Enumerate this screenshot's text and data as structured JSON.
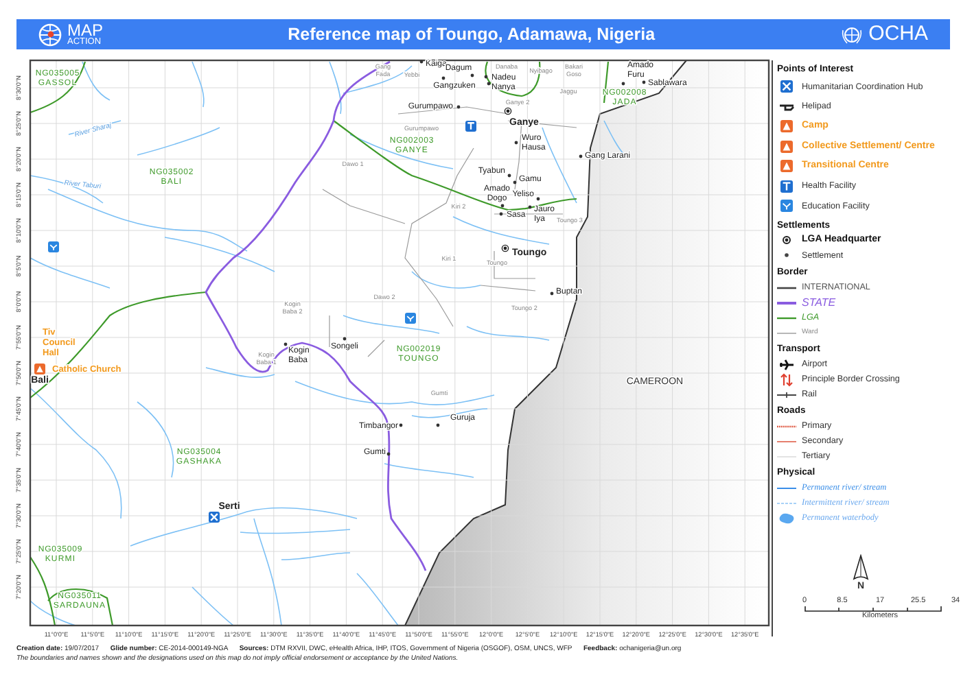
{
  "header": {
    "logo_line_1": "MAP",
    "logo_line_2": "ACTION",
    "title": "Reference map of Toungo, Adamawa, Nigeria",
    "agency": "OCHA"
  },
  "map": {
    "latitude_labels": [
      "8°30'0\"N",
      "8°25'0\"N",
      "8°20'0\"N",
      "8°15'0\"N",
      "8°10'0\"N",
      "8°5'0\"N",
      "8°0'0\"N",
      "7°55'0\"N",
      "7°50'0\"N",
      "7°45'0\"N",
      "7°40'0\"N",
      "7°35'0\"N",
      "7°30'0\"N",
      "7°25'0\"N",
      "7°20'0\"N"
    ],
    "longitude_labels": [
      "11°0'0\"E",
      "11°5'0\"E",
      "11°10'0\"E",
      "11°15'0\"E",
      "11°20'0\"E",
      "11°25'0\"E",
      "11°30'0\"E",
      "11°35'0\"E",
      "11°40'0\"E",
      "11°45'0\"E",
      "11°50'0\"E",
      "11°55'0\"E",
      "12°0'0\"E",
      "12°5'0\"E",
      "12°10'0\"E",
      "12°15'0\"E",
      "12°20'0\"E",
      "12°25'0\"E",
      "12°30'0\"E",
      "12°35'0\"E"
    ],
    "country_label": "CAMEROON",
    "admin_areas": [
      {
        "code": "NG035005",
        "name": "GASSOL"
      },
      {
        "code": "NG035002",
        "name": "BALI"
      },
      {
        "code": "NG002003",
        "name": "GANYE"
      },
      {
        "code": "NG002008",
        "name": "JADA"
      },
      {
        "code": "NG002019",
        "name": "TOUNGO"
      },
      {
        "code": "NG035004",
        "name": "GASHAKA"
      },
      {
        "code": "NG035009",
        "name": "KURMI"
      },
      {
        "code": "NG035011",
        "name": "SARDAUNA"
      }
    ],
    "settlements": [
      {
        "name": "Kaiga",
        "kind": "settlement"
      },
      {
        "name": "Dagum",
        "kind": "settlement"
      },
      {
        "name": "Gangzuken",
        "kind": "settlement"
      },
      {
        "name": "Nadeu",
        "kind": "settlement"
      },
      {
        "name": "Nanya",
        "kind": "settlement"
      },
      {
        "name": "Amado Furu",
        "kind": "settlement"
      },
      {
        "name": "Sablawara",
        "kind": "settlement"
      },
      {
        "name": "Gurumpawo",
        "kind": "settlement"
      },
      {
        "name": "Ganye",
        "kind": "lga_hq"
      },
      {
        "name": "Wuro Hausa",
        "kind": "settlement"
      },
      {
        "name": "Gang Larani",
        "kind": "settlement"
      },
      {
        "name": "Tyabun",
        "kind": "settlement"
      },
      {
        "name": "Gamu",
        "kind": "settlement"
      },
      {
        "name": "Amado Dogo",
        "kind": "settlement"
      },
      {
        "name": "Yeliso",
        "kind": "settlement"
      },
      {
        "name": "Jauro Iya",
        "kind": "settlement"
      },
      {
        "name": "Sasa",
        "kind": "settlement"
      },
      {
        "name": "Toungo",
        "kind": "lga_hq"
      },
      {
        "name": "Buptan",
        "kind": "settlement"
      },
      {
        "name": "Songeli",
        "kind": "settlement"
      },
      {
        "name": "Kogin Baba",
        "kind": "settlement"
      },
      {
        "name": "Guruja",
        "kind": "settlement"
      },
      {
        "name": "Timbangor",
        "kind": "settlement"
      },
      {
        "name": "Gumti",
        "kind": "settlement"
      },
      {
        "name": "Serti",
        "kind": "town"
      },
      {
        "name": "Bali",
        "kind": "town"
      }
    ],
    "ward_labels": [
      "Gang Fada",
      "Yebbi",
      "Danaba",
      "Nyibago",
      "Bakari Goso",
      "Jaggu",
      "Ganye 2",
      "Gurumpawo",
      "Dawo 1",
      "Kiri 2",
      "Toungo 3",
      "Kiri 1",
      "Toungo",
      "Toungo 2",
      "Dawo 2",
      "Kogin Baba 2",
      "Kogin Baba 1",
      "Gumti"
    ],
    "river_labels": [
      "River Sharaj",
      "River Taburi"
    ],
    "facilities": [
      {
        "kind": "education"
      },
      {
        "kind": "health"
      },
      {
        "kind": "education"
      },
      {
        "kind": "hub"
      }
    ],
    "camps": [
      {
        "name": "Tiv Council Hall",
        "kind": "label_only"
      },
      {
        "name": "Catholic Church",
        "kind": "camp"
      }
    ]
  },
  "legend": {
    "sections": [
      {
        "title": "Points of Interest",
        "items": [
          {
            "label": "Humanitarian Coordination Hub",
            "kind": "hub"
          },
          {
            "label": "Helipad",
            "kind": "helipad"
          },
          {
            "label": "Camp",
            "kind": "camp"
          },
          {
            "label": "Collective Settlement/ Centre",
            "kind": "collective"
          },
          {
            "label": "Transitional Centre",
            "kind": "transitional"
          },
          {
            "label": "Health Facility",
            "kind": "health"
          },
          {
            "label": "Education Facility",
            "kind": "education"
          }
        ]
      },
      {
        "title": "Settlements",
        "items": [
          {
            "label": "LGA Headquarter",
            "kind": "lga_hq"
          },
          {
            "label": "Settlement",
            "kind": "settlement"
          }
        ]
      },
      {
        "title": "Border",
        "items": [
          {
            "label": "INTERNATIONAL",
            "kind": "international"
          },
          {
            "label": "STATE",
            "kind": "state"
          },
          {
            "label": "LGA",
            "kind": "lga"
          },
          {
            "label": "Ward",
            "kind": "ward"
          }
        ]
      },
      {
        "title": "Transport",
        "items": [
          {
            "label": "Airport",
            "kind": "airport"
          },
          {
            "label": "Principle Border Crossing",
            "kind": "border_crossing"
          },
          {
            "label": "Rail",
            "kind": "rail"
          }
        ]
      },
      {
        "title": "Roads",
        "items": [
          {
            "label": "Primary",
            "kind": "primary"
          },
          {
            "label": "Secondary",
            "kind": "secondary"
          },
          {
            "label": "Tertiary",
            "kind": "tertiary"
          }
        ]
      },
      {
        "title": "Physical",
        "items": [
          {
            "label": "Permanent river/ stream",
            "kind": "river"
          },
          {
            "label": "Intermittent river/ stream",
            "kind": "intermittent"
          },
          {
            "label": "Permanent waterbody",
            "kind": "waterbody"
          }
        ]
      }
    ]
  },
  "scale": {
    "north": "N",
    "ticks": [
      "0",
      "8.5",
      "17",
      "25.5",
      "34"
    ],
    "unit": "Kilometers"
  },
  "footer": {
    "credits": "**Creation date:** 19/07/2017      **Glide number:** CE-2014-000149-NGA      **Sources:** DTM RXVII, DWC, eHealth Africa, IHP, ITOS, Government of Nigeria (OSGOF), OSM, UNCS, WFP      **Feedback:** ochanigeria@un.org",
    "disclaimer": "The boundaries and names shown and the designations used on this map do not imply official endorsement or acceptance by the United Nations."
  }
}
